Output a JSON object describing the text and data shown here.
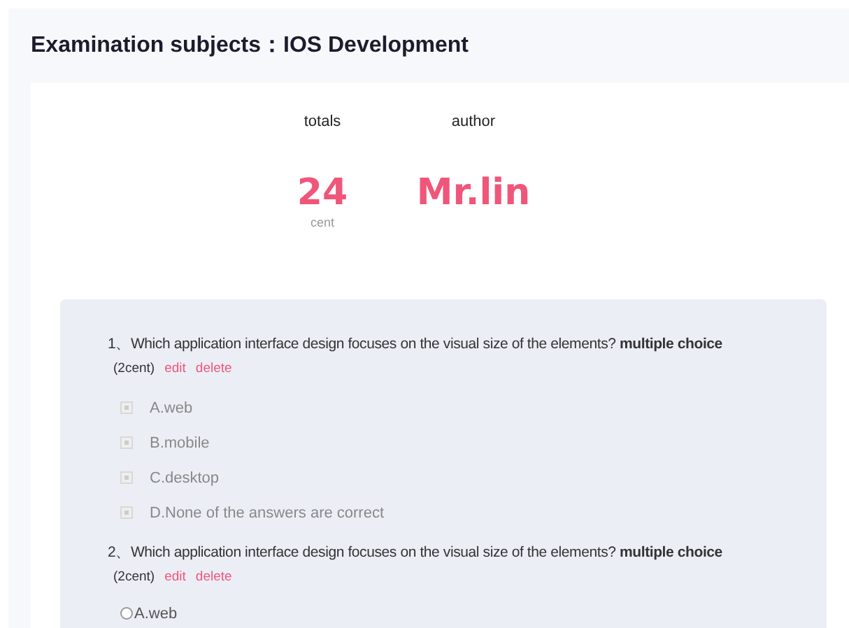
{
  "title": "Examination subjects：IOS Development",
  "summary": [
    {
      "label": "totals",
      "value": "24",
      "unit": "cent"
    },
    {
      "label": "author",
      "value": "Mr.lin"
    }
  ],
  "questions": [
    {
      "text": "1、Which application interface design focuses on the visual size of the elements? **multiple choice**",
      "score": "(2cent)",
      "actions": [
        "edit",
        "delete"
      ],
      "kind": "checkbox",
      "options": [
        {
          "label": "A.web",
          "checked": false,
          "disabled": true
        },
        {
          "label": "B.mobile",
          "checked": false,
          "disabled": true
        },
        {
          "label": "C.desktop",
          "checked": false,
          "disabled": true
        },
        {
          "label": "D.None of the answers are correct",
          "checked": false,
          "disabled": true
        }
      ]
    },
    {
      "text": "2、Which application interface design focuses on the visual size of the elements? **multiple choice**",
      "score": "(2cent)",
      "actions": [
        "edit",
        "delete"
      ],
      "kind": "radio",
      "options": [
        {
          "label": "A.web",
          "checked": false,
          "disabled": false
        }
      ]
    }
  ]
}
